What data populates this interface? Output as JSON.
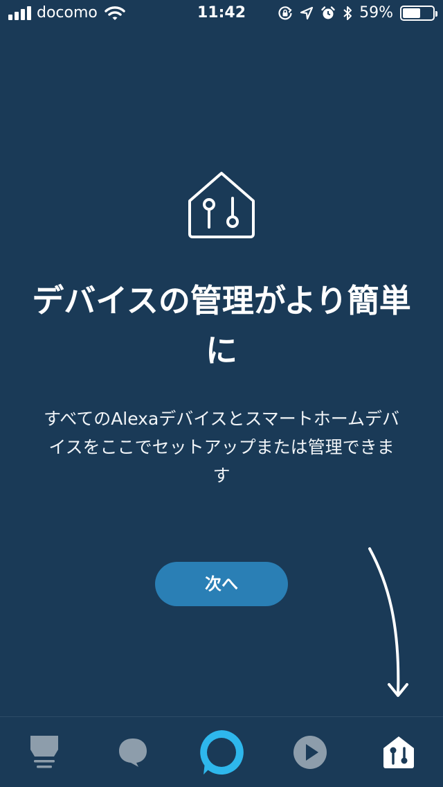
{
  "status_bar": {
    "carrier": "docomo",
    "time": "11:42",
    "battery_percent_label": "59%",
    "battery_level": 0.59,
    "icons": [
      "signal-icon",
      "wifi-icon",
      "rotation-lock-icon",
      "location-icon",
      "alarm-icon",
      "bluetooth-icon",
      "battery-icon"
    ]
  },
  "onboarding": {
    "icon": "smart-home-icon",
    "title": "デバイスの管理がより簡単に",
    "description": "すべてのAlexaデバイスとスマートホームデバイスをここでセットアップまたは管理できます",
    "next_label": "次へ",
    "hint_icon": "curved-arrow-down-icon"
  },
  "tab_bar": {
    "tabs": [
      {
        "icon": "home-feed-icon",
        "active": false
      },
      {
        "icon": "communicate-icon",
        "active": false
      },
      {
        "icon": "alexa-ring-icon",
        "active": false
      },
      {
        "icon": "play-icon",
        "active": false
      },
      {
        "icon": "devices-icon",
        "active": true
      }
    ]
  },
  "colors": {
    "background": "#1a3a57",
    "button": "#2a7fb5",
    "alexa_ring": "#2eb7ec",
    "inactive_tab": "#8d9dab"
  }
}
